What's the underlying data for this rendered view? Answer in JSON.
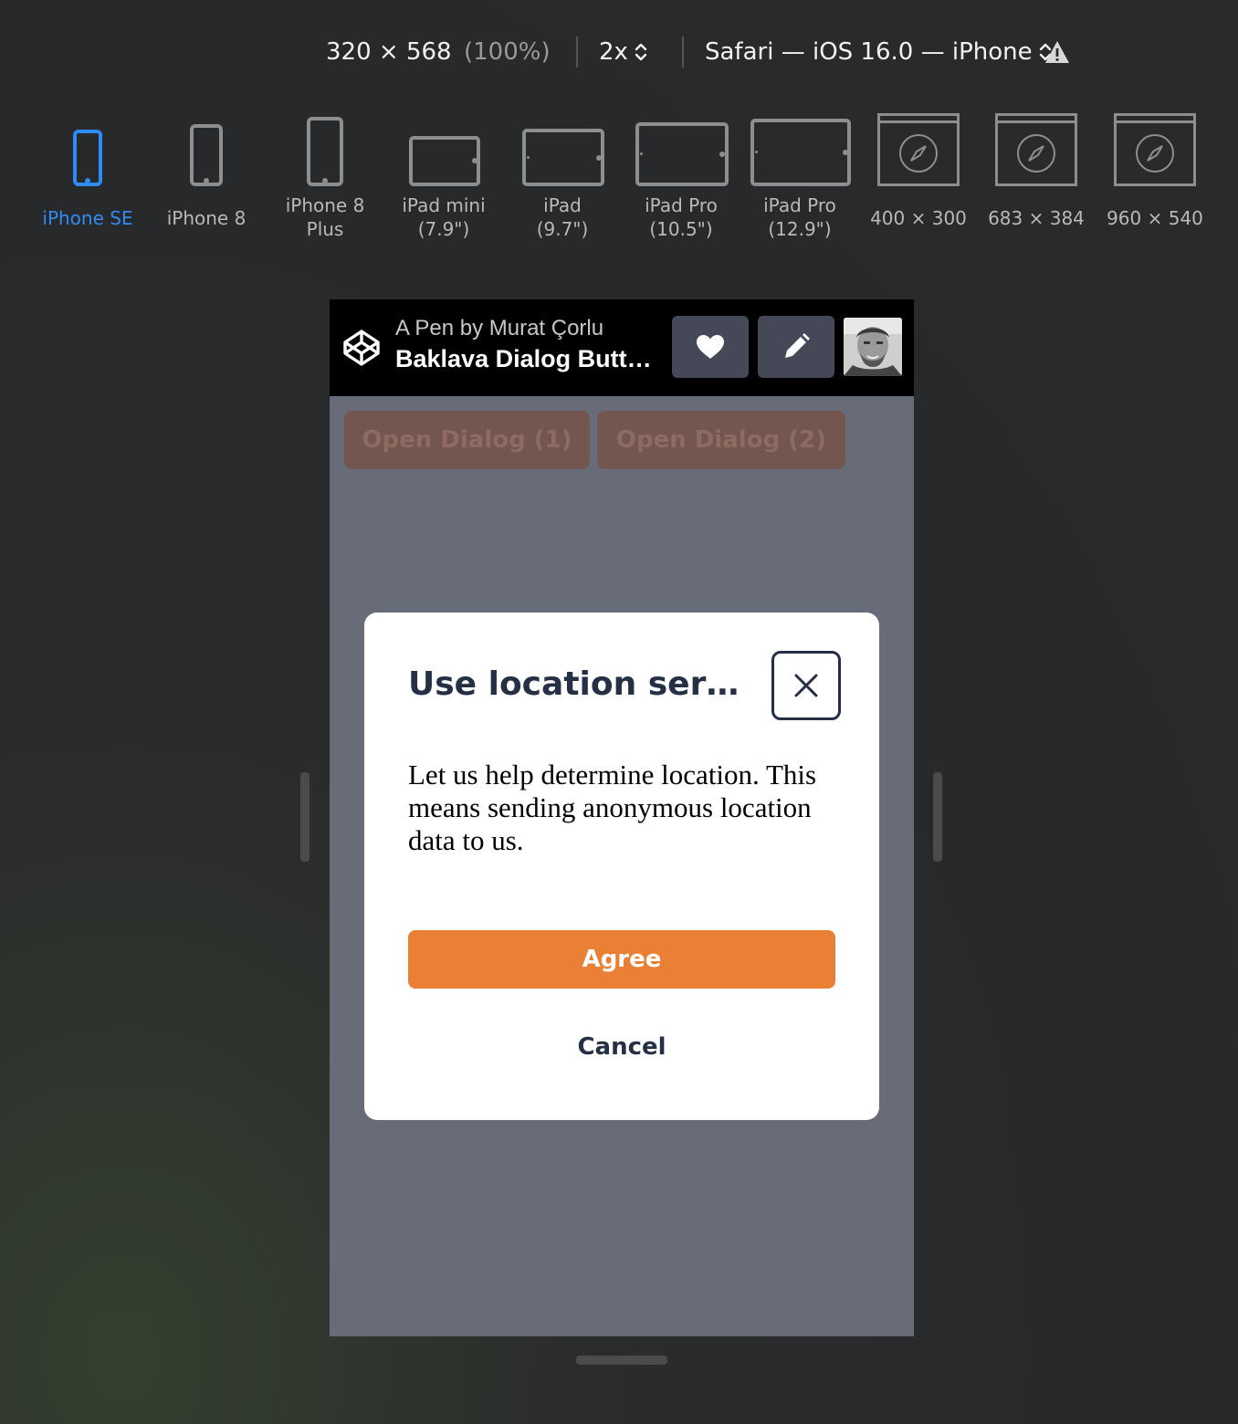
{
  "toolbar": {
    "dimensions": "320 × 568",
    "zoom": "(100%)",
    "scale": "2x",
    "browser": "Safari — iOS 16.0 — iPhone"
  },
  "devices": [
    {
      "label": "iPhone SE",
      "active": true
    },
    {
      "label": "iPhone 8",
      "active": false
    },
    {
      "label": "iPhone 8\nPlus",
      "line1": "iPhone 8",
      "line2": "Plus",
      "active": false
    },
    {
      "label": "iPad mini (7.9\")",
      "line1": "iPad mini",
      "line2": "(7.9\")",
      "active": false
    },
    {
      "label": "iPad (9.7\")",
      "line1": "iPad",
      "line2": "(9.7\")",
      "active": false
    },
    {
      "label": "iPad Pro (10.5\")",
      "line1": "iPad Pro",
      "line2": "(10.5\")",
      "active": false
    },
    {
      "label": "iPad Pro (12.9\")",
      "line1": "iPad Pro",
      "line2": "(12.9\")",
      "active": false
    },
    {
      "label": "400 × 300",
      "active": false
    },
    {
      "label": "683 × 384",
      "active": false
    },
    {
      "label": "960 × 540",
      "active": false
    }
  ],
  "pen": {
    "by": "A Pen by Murat Çorlu",
    "title": "Baklava Dialog Buttons",
    "heart_icon": "heart-icon",
    "edit_icon": "pencil-icon"
  },
  "page": {
    "open_dialog_1": "Open Dialog (1)",
    "open_dialog_2": "Open Dialog (2)"
  },
  "dialog": {
    "title": "Use location services",
    "body": "Let us help determine location. This means sending anonymous location data to us.",
    "agree": "Agree",
    "cancel": "Cancel"
  },
  "colors": {
    "accent_blue": "#2f8cf5",
    "agree_orange": "#e98035",
    "dialog_text": "#253045",
    "viewport_bg": "#676c78"
  }
}
